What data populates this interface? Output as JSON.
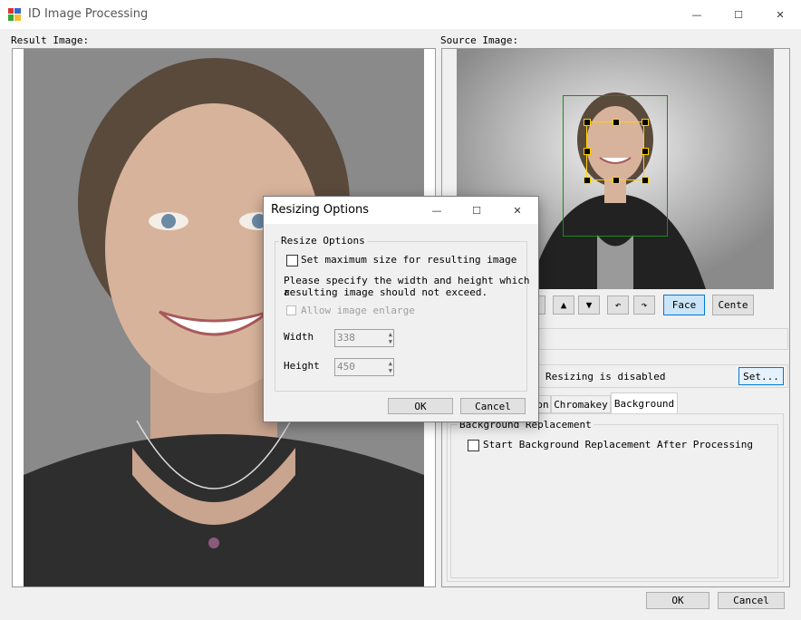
{
  "window": {
    "title": "ID Image Processing",
    "minimize_glyph": "—",
    "maximize_glyph": "☐",
    "close_glyph": "✕"
  },
  "result": {
    "label": "Result Image:"
  },
  "source": {
    "label": "Source Image:"
  },
  "controls": {
    "up_glyph": "▲",
    "down_glyph": "▼",
    "rotate_left_glyph": "↶",
    "rotate_right_glyph": "↷",
    "face_label": "Face",
    "center_label": "Cente"
  },
  "resize_row": {
    "text": "Resizing is disabled",
    "set_label": "Set..."
  },
  "tabs": [
    {
      "label": "on"
    },
    {
      "label": "Chromakey"
    },
    {
      "label": "Background"
    }
  ],
  "background_tab": {
    "group_label": "Background Replacement",
    "start_label": "Start Background Replacement After Processing"
  },
  "footer": {
    "ok_label": "OK",
    "cancel_label": "Cancel"
  },
  "dialog": {
    "title": "Resizing Options",
    "minimize_glyph": "—",
    "maximize_glyph": "☐",
    "close_glyph": "✕",
    "group_label": "Resize Options",
    "set_max_label": "Set maximum size for resulting image",
    "hint_line1": "Please specify the width and height which a",
    "hint_line2": "resulting image should not exceed.",
    "allow_enlarge_label": "Allow image enlarge",
    "width_label": "Width",
    "width_value": "338",
    "height_label": "Height",
    "height_value": "450",
    "ok_label": "OK",
    "cancel_label": "Cancel"
  },
  "colors": {
    "face_box": "#ffd200",
    "head_box": "#1a8a1a",
    "accent_button": "#cce4f7"
  }
}
